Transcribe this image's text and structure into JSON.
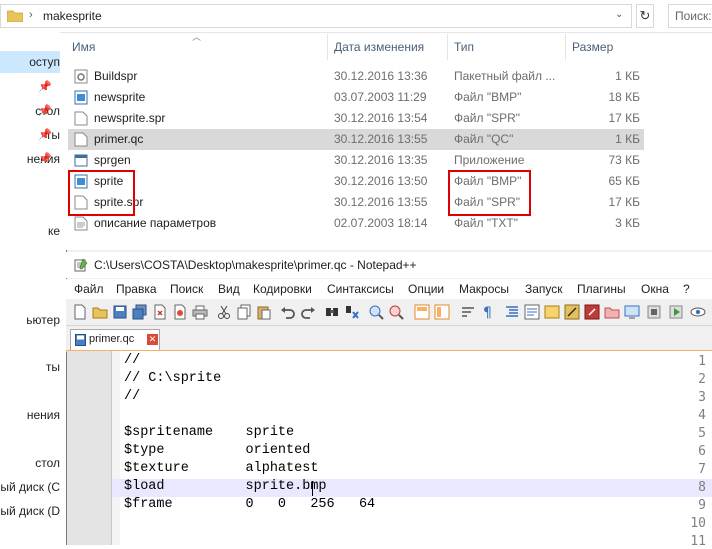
{
  "explorer": {
    "path": "makesprite",
    "search_placeholder": "Поиск:",
    "nav_items": [
      "оступ",
      "стол",
      "ты",
      "нения",
      "ке",
      "ьютер",
      "ты",
      "нения",
      "стол",
      "ный диск (С",
      "ный диск (D"
    ],
    "columns": {
      "name": "Имя",
      "date": "Дата изменения",
      "type": "Тип",
      "size": "Размер"
    },
    "files": [
      {
        "name": "Buildspr",
        "date": "30.12.2016 13:36",
        "type": "Пакетный файл ...",
        "size": "1 КБ",
        "icon": "batch-file-icon"
      },
      {
        "name": "newsprite",
        "date": "03.07.2003 11:29",
        "type": "Файл \"BMP\"",
        "size": "18 КБ",
        "icon": "bmp-file-icon"
      },
      {
        "name": "newsprite.spr",
        "date": "30.12.2016 13:54",
        "type": "Файл \"SPR\"",
        "size": "17 КБ",
        "icon": "file-icon"
      },
      {
        "name": "primer.qc",
        "date": "30.12.2016 13:55",
        "type": "Файл \"QC\"",
        "size": "1 КБ",
        "icon": "file-icon",
        "selected": true
      },
      {
        "name": "sprgen",
        "date": "30.12.2016 13:35",
        "type": "Приложение",
        "size": "73 КБ",
        "icon": "app-icon"
      },
      {
        "name": "sprite",
        "date": "30.12.2016 13:50",
        "type": "Файл \"BMP\"",
        "size": "65 КБ",
        "icon": "bmp-file-icon"
      },
      {
        "name": "sprite.spr",
        "date": "30.12.2016 13:55",
        "type": "Файл \"SPR\"",
        "size": "17 КБ",
        "icon": "file-icon"
      },
      {
        "name": "описание параметров",
        "date": "02.07.2003 18:14",
        "type": "Файл \"TXT\"",
        "size": "3 КБ",
        "icon": "text-file-icon"
      }
    ],
    "highlight_color": "#e10000",
    "selection_color": "#d9d9d9"
  },
  "notepad": {
    "title": "C:\\Users\\COSTA\\Desktop\\makesprite\\primer.qc - Notepad++",
    "menu": [
      "Файл",
      "Правка",
      "Поиск",
      "Вид",
      "Кодировки",
      "Синтаксисы",
      "Опции",
      "Макросы",
      "Запуск",
      "Плагины",
      "Окна",
      "?"
    ],
    "tab_label": "primer.qc",
    "line_numbers": [
      "1",
      "2",
      "3",
      "4",
      "5",
      "6",
      "7",
      "8",
      "9",
      "10",
      "11"
    ],
    "lines": [
      "//",
      "// C:\\sprite",
      "//",
      "",
      "$spritename    sprite",
      "$type          oriented",
      "$texture       alphatest",
      "$load          sprite.bmp",
      "$frame         0   0   256   64",
      "",
      ""
    ],
    "current_line": 8,
    "current_line_color": "#e8e8ff"
  }
}
